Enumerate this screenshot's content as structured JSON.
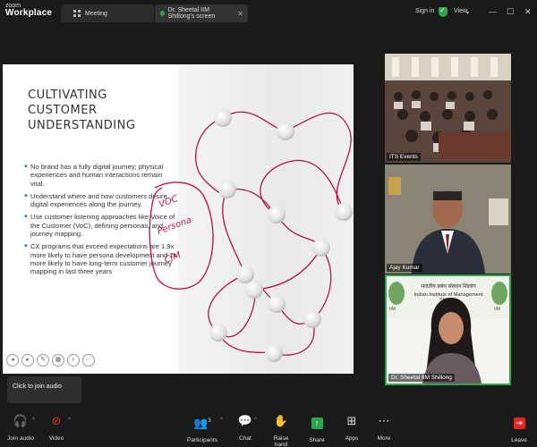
{
  "app": {
    "logo_line1": "zoom",
    "logo_line2": "Workplace"
  },
  "tabs": [
    {
      "label": "Meeting"
    },
    {
      "label": "Dr. Sheetal IIM Shillong's screen"
    }
  ],
  "header_right": {
    "sign_in": "Sign in",
    "view": "View"
  },
  "slide": {
    "title_line1": "CULTIVATING CUSTOMER",
    "title_line2": "UNDERSTANDING",
    "bullets": [
      "No brand has a fully digital journey; physical experiences and human interactions remain vital.",
      "Understand where and how customers desire digital experiences along the journey.",
      "Use customer listening approaches like Voice of the Customer (VoC), defining personas, and journey mapping.",
      "CX programs that exceed expectations are 1.9x more likely to have persona development and 2x more likely to have long-term customer journey mapping in last three years"
    ],
    "annotation_lines": [
      "VOC",
      "Persona",
      "CJM"
    ]
  },
  "participants": [
    {
      "name": "ITS Events"
    },
    {
      "name": "Ajay Kumar"
    },
    {
      "name": "Dr. Sheetal IIM Shillong",
      "banner_line1": "भारतीय प्रबंध संस्थान शिलांग",
      "banner_line2": "Indian Institute of Management Shillong",
      "logo_text": "IIM"
    }
  ],
  "tooltip": {
    "text": "Click to join audio"
  },
  "toolbar": {
    "join_audio": "Join audio",
    "video": "Video",
    "participants": "Participants",
    "participants_count": "3",
    "chat": "Chat",
    "raise_hand": "Raise hand",
    "share": "Share",
    "apps": "Apps",
    "more": "More",
    "leave": "Leave"
  },
  "colors": {
    "accent_green": "#2da44e",
    "leave_red": "#e02828",
    "annotation": "#c2185b"
  }
}
